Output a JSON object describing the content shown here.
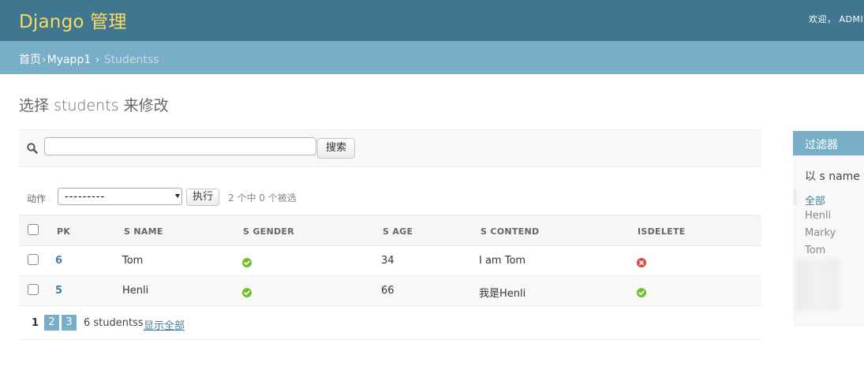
{
  "header": {
    "site_title": "Django 管理",
    "user_tools": "欢迎， ADMIN"
  },
  "breadcrumbs": {
    "home": "首页",
    "app": "Myapp1",
    "current": "Studentss",
    "separator": "›"
  },
  "page_title": "选择 students 来修改",
  "search": {
    "value": "",
    "button_label": "搜索"
  },
  "actions": {
    "label": "动作",
    "selected_option": "---------",
    "run_label": "执行",
    "counter": "2 个中 0 个被选"
  },
  "table": {
    "columns": [
      "PK",
      "S NAME",
      "S GENDER",
      "S AGE",
      "S CONTEND",
      "ISDELETE"
    ],
    "rows": [
      {
        "pk": "6",
        "s_name": "Tom",
        "s_gender": true,
        "s_age": "34",
        "s_contend": "I am Tom",
        "isdelete": false
      },
      {
        "pk": "5",
        "s_name": "Henli",
        "s_gender": true,
        "s_age": "66",
        "s_contend": "我是Henli",
        "isdelete": true
      }
    ]
  },
  "paginator": {
    "current_page": "1",
    "pages": [
      "2",
      "3"
    ],
    "result_count": "6 studentss",
    "show_all": "显示全部"
  },
  "filter": {
    "title": "过滤器",
    "subtitle": "以 s name",
    "items": [
      "全部",
      "Henli",
      "Marky",
      "Tom"
    ],
    "selected_index": 0
  },
  "colors": {
    "header_bg": "#417690",
    "breadcrumb_bg": "#79aec8",
    "site_title": "#f5dd5d",
    "link": "#447e9b",
    "bool_yes": "#70bf2b",
    "bool_no": "#dd4646"
  },
  "icons": {
    "search": "magnifier-icon",
    "bool_yes": "check-circle-icon",
    "bool_no": "x-circle-icon"
  }
}
